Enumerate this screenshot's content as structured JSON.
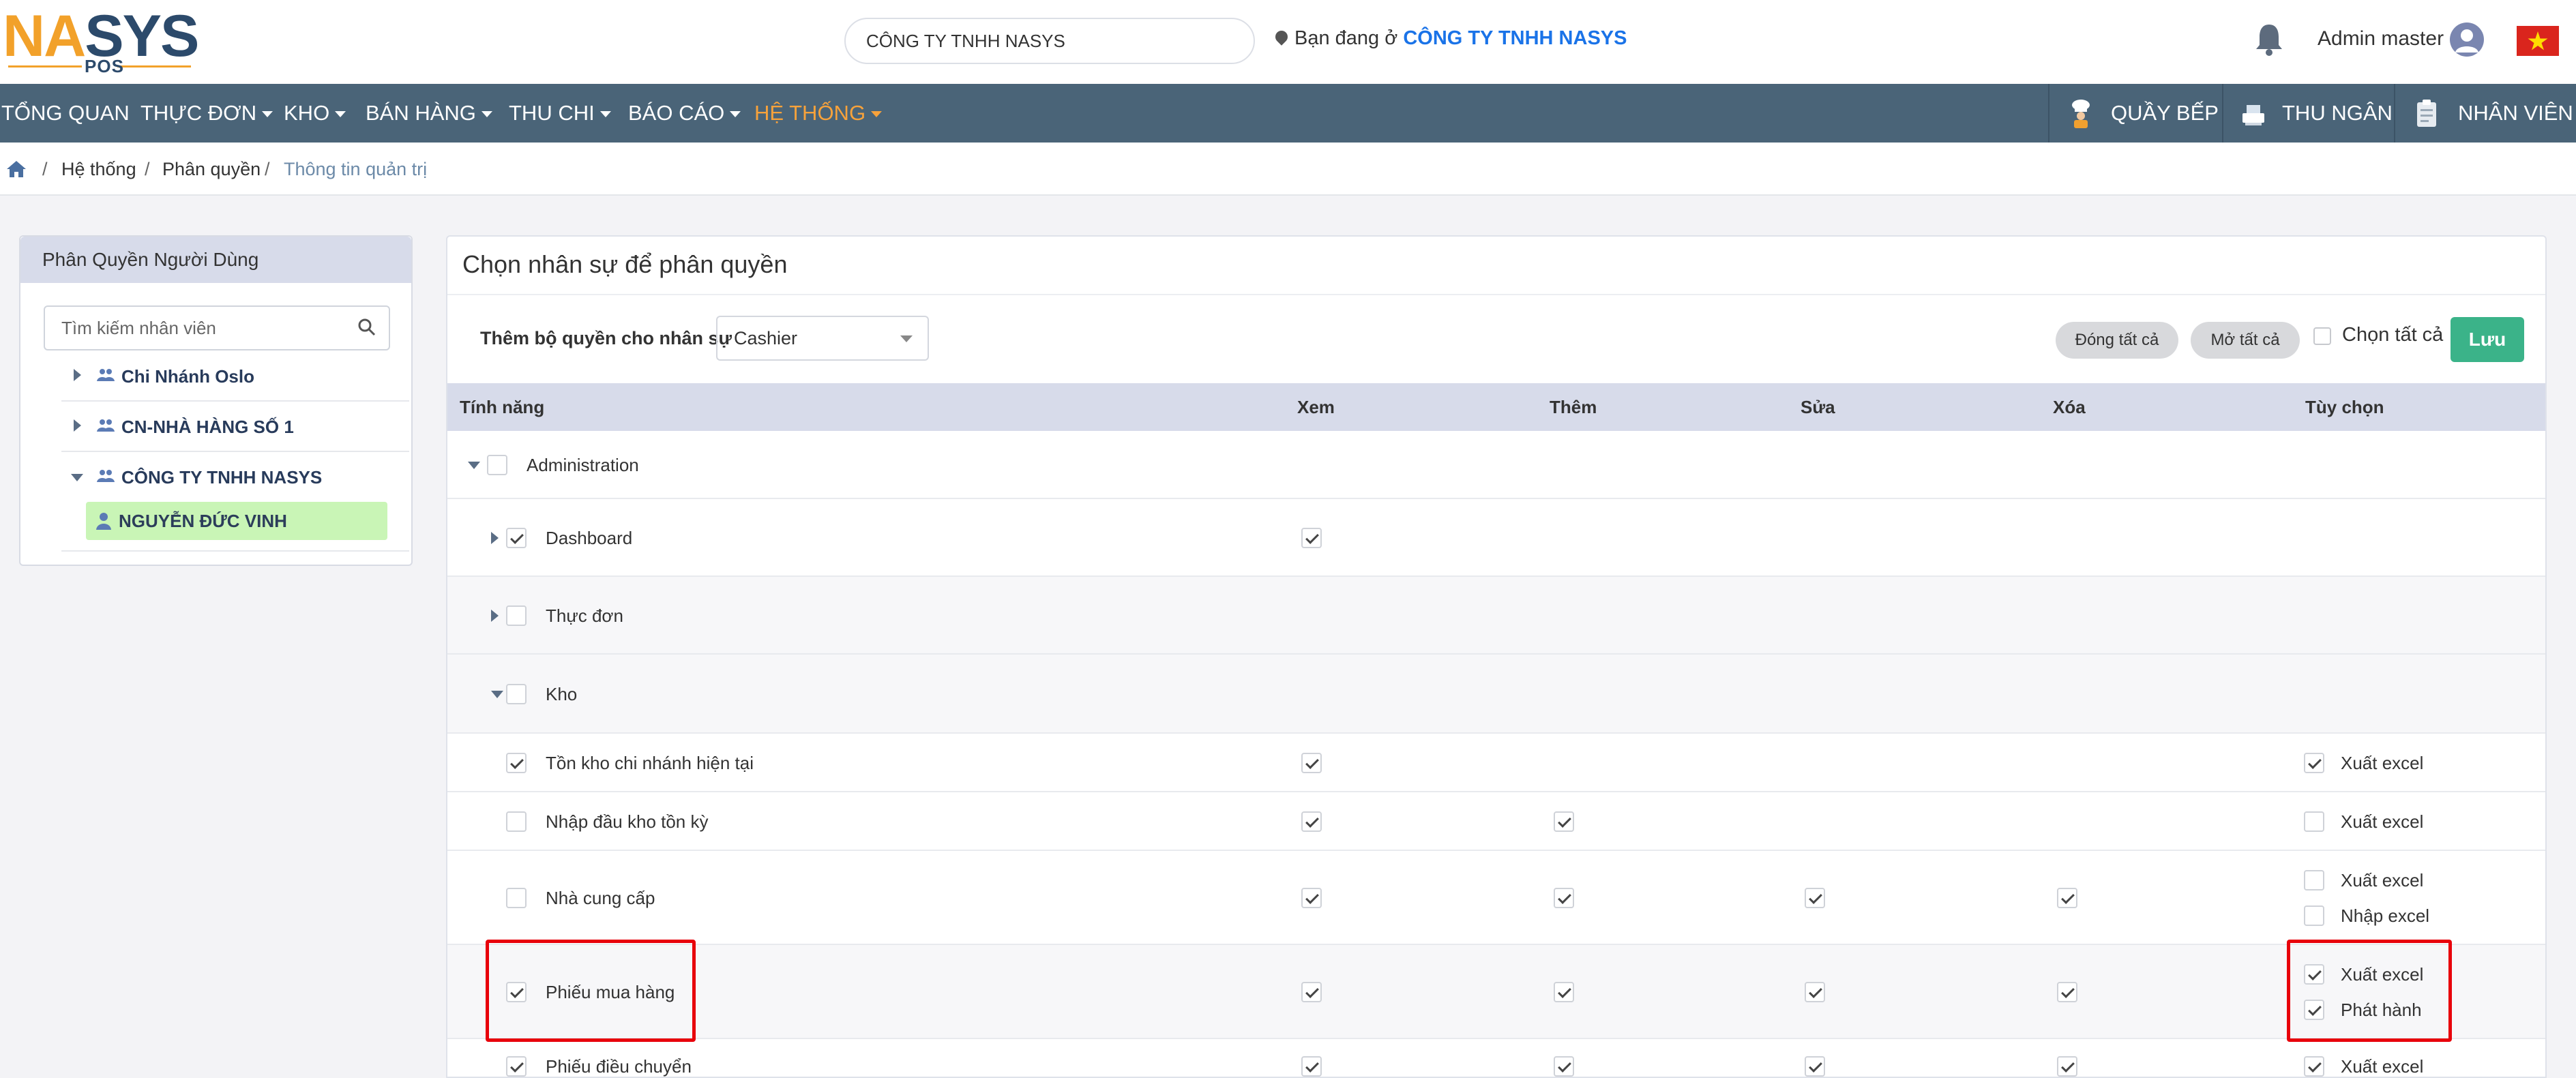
{
  "brand": {
    "logo_text_a": "NA",
    "logo_text_b": "SYS",
    "logo_sub": "POS",
    "accent": "#f2a12a",
    "primary": "#2c4a6b"
  },
  "header": {
    "company_value": "CÔNG TY TNHH NASYS",
    "location_prefix": "Bạn đang ở",
    "location_company": "CÔNG TY TNHH NASYS",
    "user_name": "Admin master",
    "icons": [
      "bell-icon",
      "user-avatar-icon",
      "vietnam-flag-icon",
      "location-pin-icon"
    ]
  },
  "nav": {
    "items": [
      {
        "label": "TỔNG QUAN",
        "dropdown": false
      },
      {
        "label": "THỰC ĐƠN",
        "dropdown": true
      },
      {
        "label": "KHO",
        "dropdown": true
      },
      {
        "label": "BÁN HÀNG",
        "dropdown": true
      },
      {
        "label": "THU CHI",
        "dropdown": true
      },
      {
        "label": "BÁO CÁO",
        "dropdown": true
      },
      {
        "label": "HỆ THỐNG",
        "dropdown": true,
        "active": true
      }
    ],
    "right": [
      {
        "label": "QUẦY BẾP",
        "icon": "chef-icon"
      },
      {
        "label": "THU NGÂN",
        "icon": "cashier-icon"
      },
      {
        "label": "NHÂN VIÊN",
        "icon": "staff-icon"
      }
    ],
    "bg": "#4a6478",
    "active_color": "#f7a23b"
  },
  "breadcrumb": {
    "items": [
      "Hệ thống",
      "Phân quyền",
      "Thông tin quản trị"
    ],
    "separator": "/"
  },
  "left_panel": {
    "title": "Phân Quyền Người Dùng",
    "search_placeholder": "Tìm kiếm nhân viên",
    "branches": [
      {
        "label": "Chi Nhánh Oslo",
        "expanded": false
      },
      {
        "label": "CN-NHÀ HÀNG SỐ 1",
        "expanded": false
      },
      {
        "label": "CÔNG TY TNHH NASYS",
        "expanded": true
      }
    ],
    "selected_user": "NGUYỄN ĐỨC VINH"
  },
  "main": {
    "title": "Chọn nhân sự để phân quyền",
    "role_label": "Thêm bộ quyền cho nhân sự",
    "role_value": "Cashier",
    "collapse_all": "Đóng tất cả",
    "expand_all": "Mở tất cả",
    "select_all": "Chọn tất cả",
    "save": "Lưu",
    "columns": {
      "feature": "Tính năng",
      "view": "Xem",
      "add": "Thêm",
      "edit": "Sửa",
      "delete": "Xóa",
      "options": "Tùy chọn"
    },
    "rows": [
      {
        "label": "Administration",
        "level": 0,
        "toggle": "down",
        "checked": false,
        "view": null,
        "add": null,
        "edit": null,
        "delete": null,
        "options": []
      },
      {
        "label": "Dashboard",
        "level": 1,
        "toggle": "right",
        "checked": true,
        "view": true,
        "add": null,
        "edit": null,
        "delete": null,
        "options": []
      },
      {
        "label": "Thực đơn",
        "level": 1,
        "toggle": "right",
        "checked": false,
        "view": null,
        "add": null,
        "edit": null,
        "delete": null,
        "options": []
      },
      {
        "label": "Kho",
        "level": 1,
        "toggle": "down",
        "checked": false,
        "view": null,
        "add": null,
        "edit": null,
        "delete": null,
        "options": []
      },
      {
        "label": "Tồn kho chi nhánh hiện tại",
        "level": 2,
        "toggle": null,
        "checked": true,
        "view": true,
        "add": null,
        "edit": null,
        "delete": null,
        "options": [
          {
            "label": "Xuất excel",
            "checked": true
          }
        ]
      },
      {
        "label": "Nhập đầu kho tồn kỳ",
        "level": 2,
        "toggle": null,
        "checked": false,
        "view": true,
        "add": true,
        "edit": null,
        "delete": null,
        "options": [
          {
            "label": "Xuất excel",
            "checked": false
          }
        ]
      },
      {
        "label": "Nhà cung cấp",
        "level": 2,
        "toggle": null,
        "checked": false,
        "view": true,
        "add": true,
        "edit": true,
        "delete": true,
        "options": [
          {
            "label": "Xuất excel",
            "checked": false
          },
          {
            "label": "Nhập excel",
            "checked": false
          }
        ]
      },
      {
        "label": "Phiếu mua hàng",
        "level": 2,
        "toggle": null,
        "checked": true,
        "view": true,
        "add": true,
        "edit": true,
        "delete": true,
        "options": [
          {
            "label": "Xuất excel",
            "checked": true
          },
          {
            "label": "Phát hành",
            "checked": true
          }
        ],
        "highlighted": true
      },
      {
        "label": "Phiếu điều chuyển",
        "level": 2,
        "toggle": null,
        "checked": true,
        "view": true,
        "add": true,
        "edit": true,
        "delete": true,
        "options": [
          {
            "label": "Xuất excel",
            "checked": true
          }
        ]
      }
    ]
  },
  "colors": {
    "save_button": "#3bb389",
    "table_header": "#d7dbea",
    "highlight": "#e8000b",
    "selected_user_bg": "#c9f5b6"
  }
}
